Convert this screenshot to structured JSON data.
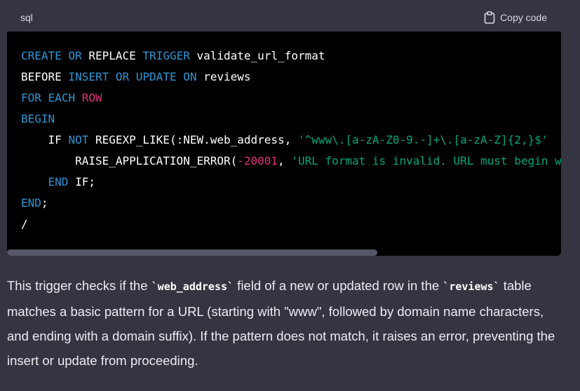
{
  "code_block": {
    "language": "sql",
    "copy_label": "Copy code",
    "copy_icon": "clipboard-icon",
    "lines": [
      [
        {
          "t": "CREATE",
          "c": "kw"
        },
        {
          "t": " "
        },
        {
          "t": "OR",
          "c": "kw"
        },
        {
          "t": " REPLACE "
        },
        {
          "t": "TRIGGER",
          "c": "kw"
        },
        {
          "t": " validate_url_format"
        }
      ],
      [
        {
          "t": "BEFORE "
        },
        {
          "t": "INSERT",
          "c": "kw"
        },
        {
          "t": " "
        },
        {
          "t": "OR",
          "c": "kw"
        },
        {
          "t": " "
        },
        {
          "t": "UPDATE",
          "c": "kw"
        },
        {
          "t": " "
        },
        {
          "t": "ON",
          "c": "kw"
        },
        {
          "t": " reviews"
        }
      ],
      [
        {
          "t": "FOR",
          "c": "kw"
        },
        {
          "t": " "
        },
        {
          "t": "EACH",
          "c": "kw"
        },
        {
          "t": " "
        },
        {
          "t": "ROW",
          "c": "kw-pink"
        }
      ],
      [
        {
          "t": "BEGIN",
          "c": "kw"
        }
      ],
      [
        {
          "t": "    IF "
        },
        {
          "t": "NOT",
          "c": "kw"
        },
        {
          "t": " REGEXP_LIKE(:NEW.web_address, "
        },
        {
          "t": "'^www\\.[a-zA-Z0-9.-]+\\.[a-zA-Z]{2,}$'",
          "c": "str"
        }
      ],
      [
        {
          "t": "        RAISE_APPLICATION_ERROR("
        },
        {
          "t": "-20001",
          "c": "num"
        },
        {
          "t": ", "
        },
        {
          "t": "'URL format is invalid. URL must begin with www.'",
          "c": "str"
        }
      ],
      [
        {
          "t": "    "
        },
        {
          "t": "END",
          "c": "kw"
        },
        {
          "t": " IF;"
        }
      ],
      [
        {
          "t": "END",
          "c": "kw"
        },
        {
          "t": ";"
        }
      ],
      [
        {
          "t": "/"
        }
      ]
    ]
  },
  "explanation": {
    "parts": [
      {
        "t": "This trigger checks if the "
      },
      {
        "t": "`web_address`",
        "code": true
      },
      {
        "t": " field of a new or updated row in the "
      },
      {
        "t": "`reviews`",
        "code": true
      },
      {
        "t": " table matches a basic pattern for a URL (starting with \"www\", followed by domain name characters, and ending with a domain suffix). If the pattern does not match, it raises an error, preventing the insert or update from proceeding."
      }
    ]
  },
  "colors": {
    "keyword": "#2e95d3",
    "keyword_pink": "#df3079",
    "string": "#00a67d",
    "number": "#df3079",
    "background": "#343541",
    "code_background": "#000000"
  }
}
